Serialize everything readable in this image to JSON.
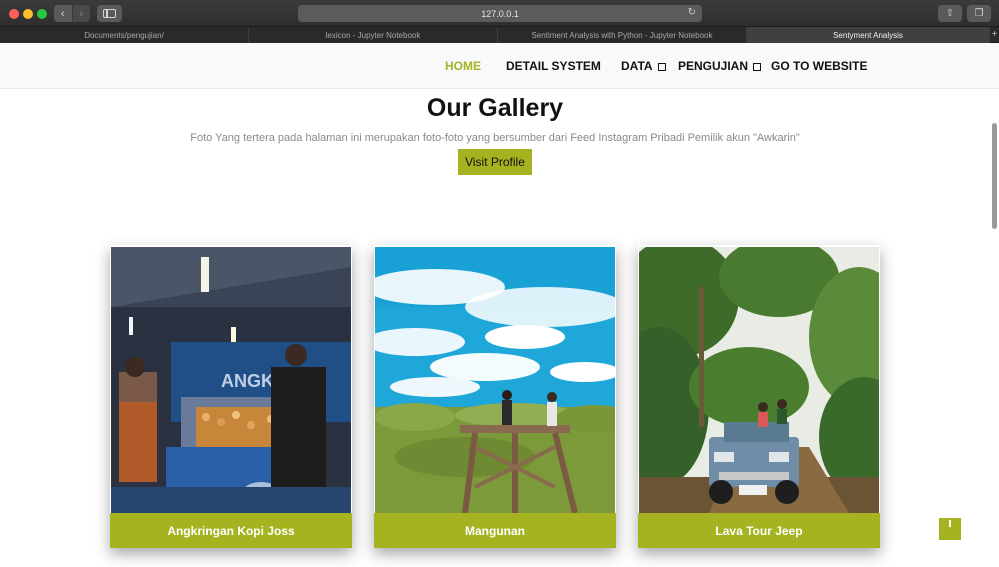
{
  "browser": {
    "url": "127.0.0.1",
    "tabs": [
      {
        "label": "Documents/pengujian/"
      },
      {
        "label": "lexicon - Jupyter Notebook"
      },
      {
        "label": "Sentiment Analysis with Python - Jupyter Notebook"
      },
      {
        "label": "Sentyment Analysis"
      }
    ],
    "new_tab": "+"
  },
  "nav": {
    "home": "HOME",
    "detail": "DETAIL SYSTEM",
    "data": "DATA",
    "pengujian": "PENGUJIAN",
    "goto": "GO TO WEBSITE"
  },
  "gallery": {
    "title": "Our Gallery",
    "subtitle": "Foto Yang tertera pada halaman ini merupakan foto-foto yang bersumber dari Feed Instagram Pribadi Pemilik akun \"Awkarin\"",
    "button": "Visit Profile",
    "cards": [
      {
        "label": "Angkringan Kopi Joss"
      },
      {
        "label": "Mangunan"
      },
      {
        "label": "Lava Tour Jeep"
      }
    ]
  },
  "colors": {
    "accent": "#a4b31f"
  },
  "icons": {
    "back": "chevron-left-icon",
    "forward": "chevron-right-icon",
    "sidebar": "sidebar-icon",
    "reload": "reload-icon",
    "share": "share-icon",
    "tabs": "tabs-overview-icon",
    "caret": "dropdown-caret-icon",
    "scroll_top": "scroll-top-icon"
  }
}
